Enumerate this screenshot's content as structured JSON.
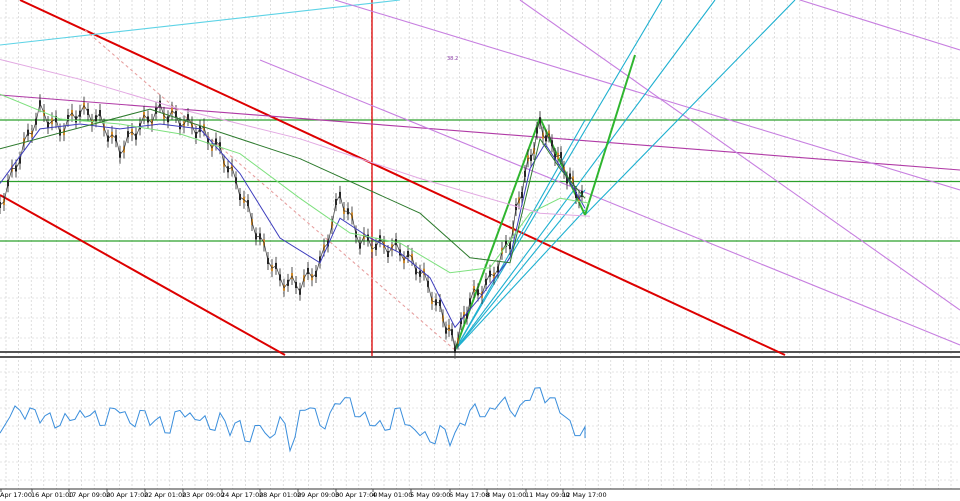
{
  "chart_data": [
    {
      "type": "line",
      "panel": "price",
      "title": "",
      "xlabel": "",
      "ylabel": "",
      "grid": true,
      "legend": "none",
      "x_tick_labels": [
        "Apr 17:00",
        "16 Apr 01:00",
        "17 Apr 09:00",
        "20 Apr 17:00",
        "22 Apr 01:00",
        "23 Apr 09:00",
        "24 Apr 17:00",
        "28 Apr 01:00",
        "29 Apr 09:00",
        "30 Apr 17:00",
        "4 May 01:00",
        "5 May 09:00",
        "6 May 17:00",
        "8 May 01:00",
        "11 May 09:00",
        "12 May 17:00"
      ],
      "xlim": [
        0,
        700
      ],
      "ylim": [
        0,
        360
      ],
      "series": [
        {
          "style": "candles",
          "color": "#000000",
          "x": [
            0,
            20,
            40,
            60,
            80,
            100,
            120,
            140,
            160,
            180,
            200,
            220,
            240,
            260,
            280,
            300,
            320,
            340,
            360,
            380,
            400,
            420,
            440,
            455,
            470,
            490,
            510,
            525,
            540,
            555,
            570,
            585
          ],
          "values": [
            205,
            155,
            110,
            130,
            110,
            120,
            150,
            125,
            110,
            120,
            130,
            150,
            190,
            240,
            280,
            285,
            265,
            195,
            240,
            245,
            250,
            270,
            310,
            345,
            300,
            280,
            240,
            175,
            125,
            150,
            180,
            205
          ]
        },
        {
          "style": "line",
          "color": "#3d3dbd",
          "x": [
            0,
            40,
            80,
            120,
            160,
            200,
            240,
            280,
            320,
            340,
            370,
            400,
            430,
            455,
            480,
            510,
            530,
            545,
            565,
            585
          ],
          "values": [
            185,
            130,
            125,
            130,
            125,
            130,
            175,
            240,
            265,
            220,
            240,
            255,
            280,
            330,
            300,
            260,
            170,
            145,
            175,
            210
          ]
        },
        {
          "style": "line",
          "color": "#7ee07e",
          "x": [
            0,
            60,
            120,
            180,
            240,
            300,
            350,
            400,
            450,
            490,
            530,
            560,
            590
          ],
          "values": [
            95,
            120,
            125,
            135,
            155,
            200,
            235,
            245,
            275,
            270,
            215,
            200,
            205
          ]
        },
        {
          "style": "line",
          "color": "#e2a8e2",
          "x": [
            0,
            80,
            180,
            300,
            420,
            540,
            590
          ],
          "values": [
            60,
            80,
            110,
            140,
            180,
            215,
            218
          ]
        },
        {
          "style": "line",
          "color": "#2d7a2d",
          "x": [
            0,
            150,
            300,
            420,
            470,
            510,
            540,
            560,
            585
          ],
          "values": [
            150,
            110,
            160,
            215,
            260,
            265,
            140,
            170,
            200
          ]
        }
      ],
      "horizontal_levels": [
        {
          "y": 121,
          "color": "#2ca02c"
        },
        {
          "y": 183,
          "color": "#2ca02c"
        },
        {
          "y": 243,
          "color": "#2ca02c"
        },
        {
          "y": 355,
          "color": "#555555"
        }
      ],
      "vertical_lines": [
        {
          "x": 372,
          "color": "#dd0000"
        }
      ],
      "trendlines": [
        {
          "points": [
            [
              20,
              0
            ],
            [
              785,
              355
            ]
          ],
          "color": "#dd0000"
        },
        {
          "points": [
            [
              0,
              195
            ],
            [
              285,
              355
            ]
          ],
          "color": "#dd0000"
        },
        {
          "points": [
            [
              0,
              95
            ],
            [
              960,
              170
            ]
          ],
          "color": "#b03aa6"
        },
        {
          "points": [
            [
              0,
              45
            ],
            [
              400,
              0
            ]
          ],
          "color": "#5ed3e6"
        },
        {
          "points": [
            [
              335,
              0
            ],
            [
              960,
              190
            ]
          ],
          "color": "#c77fe0"
        },
        {
          "points": [
            [
              520,
              0
            ],
            [
              960,
              310
            ]
          ],
          "color": "#c77fe0"
        },
        {
          "points": [
            [
              260,
              60
            ],
            [
              960,
              345
            ]
          ],
          "color": "#c77fe0"
        },
        {
          "points": [
            [
              800,
              0
            ],
            [
              960,
              50
            ]
          ],
          "color": "#c77fe0"
        },
        {
          "points": [
            [
              85,
              30
            ],
            [
              455,
              350
            ]
          ],
          "color": "#e7a0a0"
        },
        {
          "points": [
            [
              455,
              350
            ],
            [
              662,
              0
            ]
          ],
          "color": "#1eb0d0"
        },
        {
          "points": [
            [
              455,
              350
            ],
            [
              715,
              0
            ]
          ],
          "color": "#1eb0d0"
        },
        {
          "points": [
            [
              455,
              350
            ],
            [
              585,
              120
            ]
          ],
          "color": "#1eb0d0"
        },
        {
          "points": [
            [
              455,
              350
            ],
            [
              585,
              210
            ]
          ],
          "color": "#1eb0d0"
        },
        {
          "points": [
            [
              455,
              350
            ],
            [
              585,
              190
            ]
          ],
          "color": "#1eb0d0"
        },
        {
          "points": [
            [
              585,
              215
            ],
            [
              795,
              0
            ]
          ],
          "color": "#1eb0d0"
        },
        {
          "points": [
            [
              455,
              350
            ],
            [
              540,
              118
            ]
          ],
          "color": "#2fb52f"
        },
        {
          "points": [
            [
              540,
              118
            ],
            [
              585,
              215
            ]
          ],
          "color": "#2fb52f"
        },
        {
          "points": [
            [
              585,
              215
            ],
            [
              635,
              55
            ]
          ],
          "color": "#2fb52f"
        }
      ],
      "annotations": [
        {
          "text": "38.2",
          "x": 447,
          "y": 60,
          "color": "#8a3aa6"
        }
      ]
    },
    {
      "type": "line",
      "panel": "oscillator",
      "title": "",
      "xlabel": "",
      "ylabel": "",
      "grid": true,
      "legend": "none",
      "xlim": [
        0,
        700
      ],
      "ylim": [
        0,
        100
      ],
      "series": [
        {
          "color": "#3a8edc",
          "x": [
            0,
            10,
            20,
            30,
            40,
            50,
            60,
            70,
            80,
            90,
            100,
            110,
            120,
            130,
            140,
            150,
            160,
            170,
            180,
            190,
            200,
            210,
            220,
            230,
            240,
            250,
            260,
            270,
            280,
            290,
            300,
            310,
            320,
            330,
            340,
            350,
            360,
            370,
            380,
            390,
            400,
            410,
            420,
            430,
            440,
            450,
            460,
            470,
            480,
            490,
            500,
            510,
            520,
            530,
            540,
            550,
            560,
            570,
            580,
            585
          ],
          "values": [
            42,
            55,
            60,
            62,
            50,
            58,
            48,
            52,
            60,
            56,
            48,
            62,
            58,
            50,
            60,
            48,
            55,
            42,
            60,
            58,
            52,
            45,
            58,
            40,
            52,
            35,
            48,
            38,
            55,
            28,
            60,
            62,
            48,
            58,
            65,
            70,
            55,
            48,
            52,
            45,
            62,
            48,
            40,
            35,
            48,
            32,
            50,
            60,
            55,
            62,
            66,
            60,
            64,
            68,
            78,
            70,
            58,
            52,
            40,
            38
          ]
        }
      ]
    }
  ]
}
